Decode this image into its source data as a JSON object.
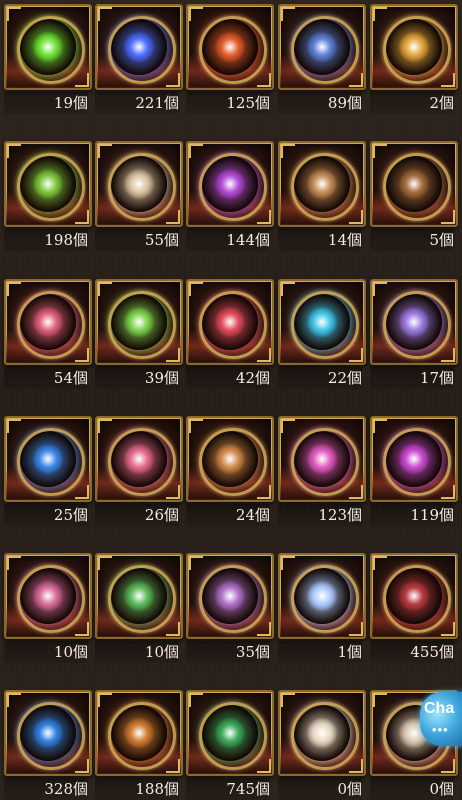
{
  "items": [
    {
      "count": "19個",
      "icon": "green-ring-icon",
      "color": "#6be032"
    },
    {
      "count": "221個",
      "icon": "blue-crystal-icon",
      "color": "#4a6cff"
    },
    {
      "count": "125個",
      "icon": "red-emblem-icon",
      "color": "#e25a2a"
    },
    {
      "count": "89個",
      "icon": "blue-gold-emblem-icon",
      "color": "#5a7fd6"
    },
    {
      "count": "2個",
      "icon": "gold-emblem-icon",
      "color": "#e1a43a"
    },
    {
      "count": "198個",
      "icon": "green-emblem-icon",
      "color": "#7cc43a"
    },
    {
      "count": "55個",
      "icon": "silver-emblem-icon",
      "color": "#d8c2a0"
    },
    {
      "count": "144個",
      "icon": "purple-emblem-icon",
      "color": "#b34ad8"
    },
    {
      "count": "14個",
      "icon": "silver-orb-icon",
      "color": "#c48a54"
    },
    {
      "count": "5個",
      "icon": "dark-orb-icon",
      "color": "#a06a3a"
    },
    {
      "count": "54個",
      "icon": "pink-orb-icon",
      "color": "#e0607c"
    },
    {
      "count": "39個",
      "icon": "green-orb-icon",
      "color": "#7bd24a"
    },
    {
      "count": "42個",
      "icon": "red-orb-icon",
      "color": "#e04a5a"
    },
    {
      "count": "22個",
      "icon": "cyan-orb-icon",
      "color": "#3ec4e6"
    },
    {
      "count": "17個",
      "icon": "violet-orb-icon",
      "color": "#9a78e0"
    },
    {
      "count": "25個",
      "icon": "blue-swirl-orb-icon",
      "color": "#3a86e8"
    },
    {
      "count": "26個",
      "icon": "ribbon-orb-icon",
      "color": "#e36a8a"
    },
    {
      "count": "24個",
      "icon": "horned-orb-icon",
      "color": "#d08848"
    },
    {
      "count": "123個",
      "icon": "rainbow-ring-icon",
      "color": "#e05ac0"
    },
    {
      "count": "119個",
      "icon": "pink-blue-ring-icon",
      "color": "#c84ad0"
    },
    {
      "count": "10個",
      "icon": "pink-hex-orb-icon",
      "color": "#d86a9a"
    },
    {
      "count": "10個",
      "icon": "green-hex-orb-icon",
      "color": "#5ab85a"
    },
    {
      "count": "35個",
      "icon": "purple-hex-orb-icon",
      "color": "#b070c8"
    },
    {
      "count": "1個",
      "icon": "crystal-gem-icon",
      "color": "#a8c8ff"
    },
    {
      "count": "455個",
      "icon": "red-ticket-icon",
      "color": "#b83a40"
    },
    {
      "count": "328個",
      "icon": "blue-ticket-icon",
      "color": "#2f7fe0"
    },
    {
      "count": "188個",
      "icon": "orange-ticket-icon",
      "color": "#d07a30"
    },
    {
      "count": "745個",
      "icon": "green-ticket-icon",
      "color": "#3aa85a"
    },
    {
      "count": "0個",
      "icon": "character-card-icon",
      "color": "#e6d8c2"
    },
    {
      "count": "0個",
      "icon": "character-card-red-icon",
      "color": "#d8c6b0"
    }
  ],
  "chat": {
    "label": "Cha",
    "dots": "•••",
    "icon": "chat-bubble-icon",
    "color": "#3fa6dc"
  }
}
